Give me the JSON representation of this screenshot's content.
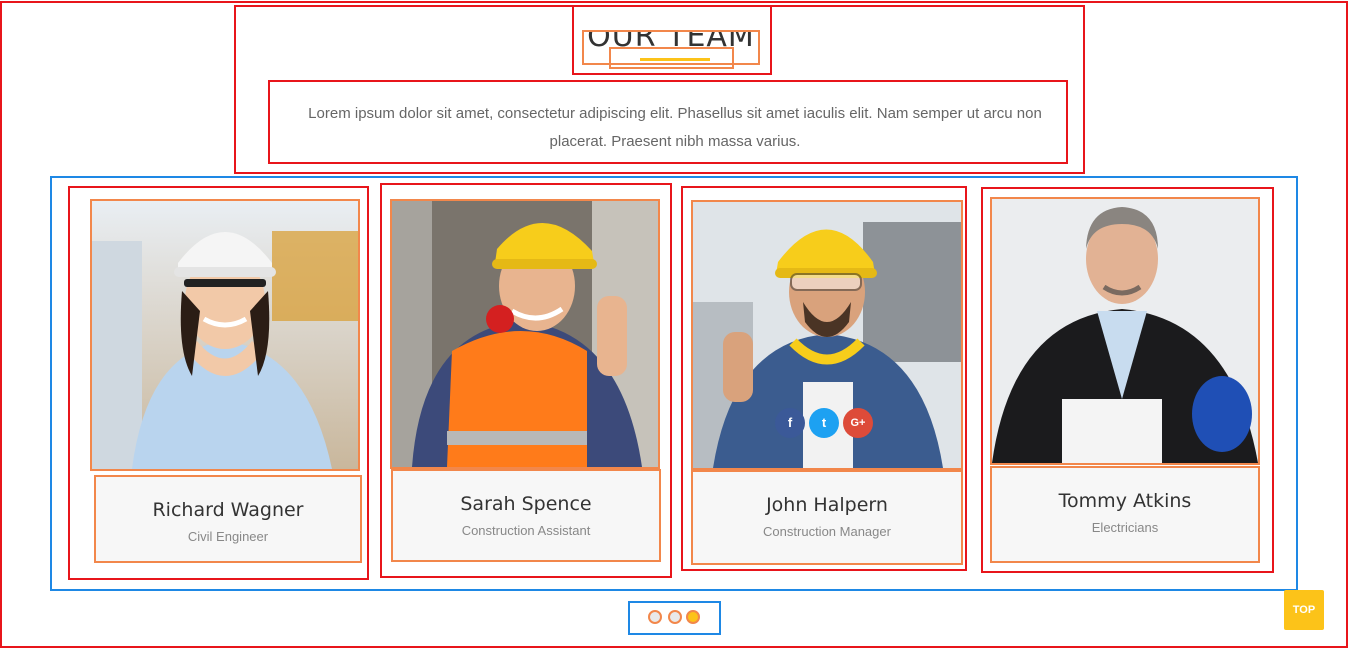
{
  "section": {
    "title": "OUR TEAM",
    "intro": "Lorem ipsum dolor sit amet, consectetur adipiscing elit. Phasellus sit amet iaculis elit. Nam semper ut arcu non placerat. Praesent nibh massa varius."
  },
  "team": [
    {
      "name": "Richard Wagner",
      "role": "Civil Engineer"
    },
    {
      "name": "Sarah Spence",
      "role": "Construction Assistant"
    },
    {
      "name": "John Halpern",
      "role": "Construction Manager"
    },
    {
      "name": "Tommy Atkins",
      "role": "Electricians"
    }
  ],
  "social": {
    "facebook": "f",
    "twitter": "t",
    "google": "G+"
  },
  "carousel": {
    "dots": 3,
    "active": 3
  },
  "top_button": "TOP",
  "colors": {
    "accent": "#fcc319",
    "facebook": "#3b5998",
    "twitter": "#1da1f2",
    "google": "#dd4b39"
  }
}
